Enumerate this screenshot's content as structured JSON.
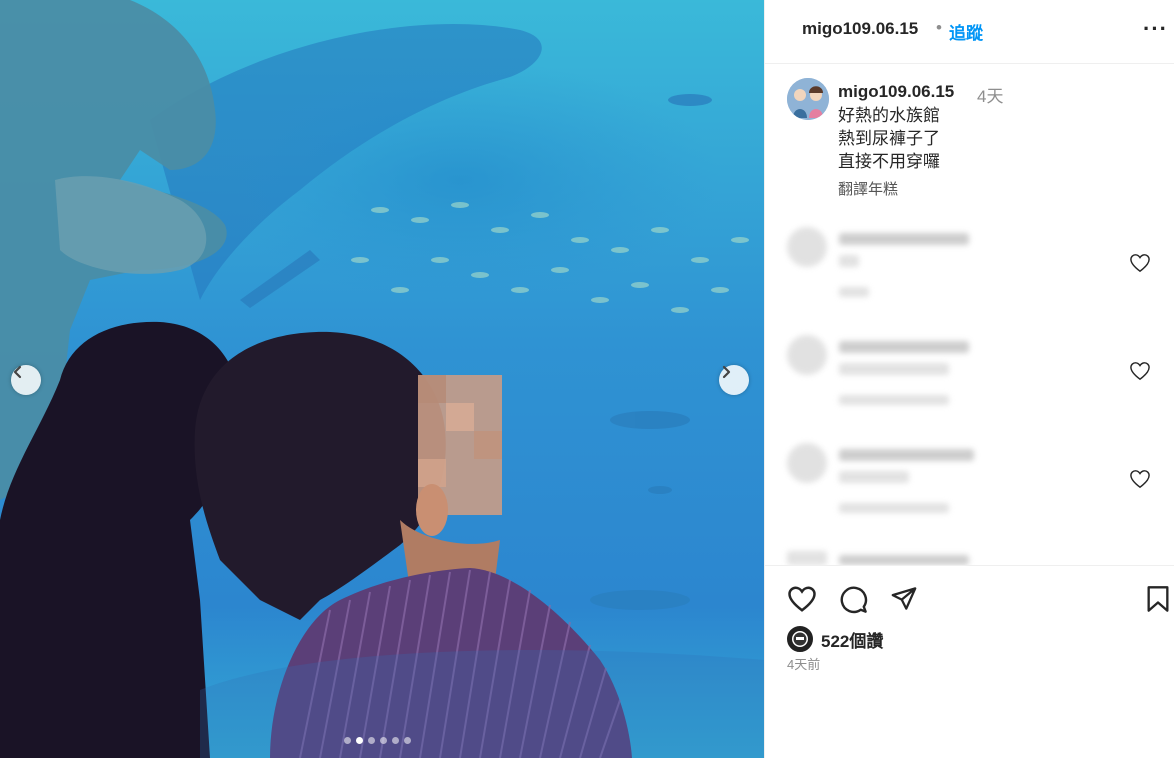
{
  "photo": {
    "carousel_dots": 6,
    "active_dot": 1
  },
  "header": {
    "username": "migo109.06.15",
    "separator": "•",
    "follow_label": "追蹤",
    "more_label": "···"
  },
  "caption": {
    "username": "migo109.06.15",
    "time": "4天",
    "lines": [
      "好熱的水族館",
      "熱到尿褲子了",
      "直接不用穿囉"
    ],
    "translate_label": "翻譯年糕"
  },
  "actions": {
    "likes_label": "522個讚",
    "posted_label": "4天前"
  },
  "colors": {
    "accent": "#0095f6",
    "text": "#262626",
    "muted": "#8e8e8e"
  }
}
